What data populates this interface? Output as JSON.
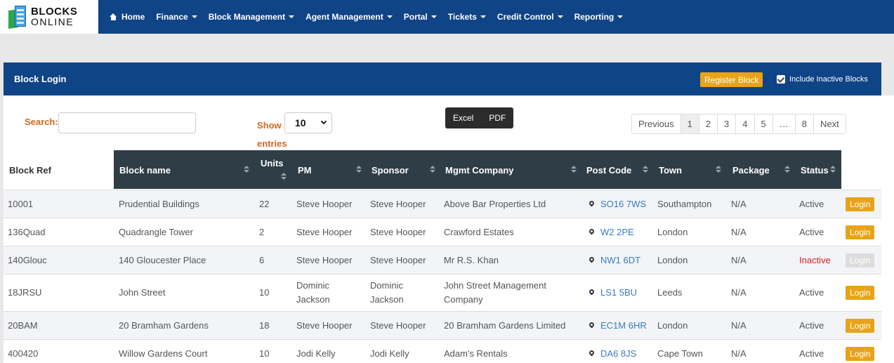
{
  "brand": {
    "line1": "BLOCKS",
    "line2": "ONLINE"
  },
  "nav": {
    "home": "Home",
    "items": [
      "Finance",
      "Block Management",
      "Agent Management",
      "Portal",
      "Tickets",
      "Credit Control",
      "Reporting"
    ]
  },
  "panel": {
    "title": "Block Login",
    "register_label": "Register Block",
    "include_inactive_label": "Include Inactive Blocks",
    "include_inactive_checked": true
  },
  "controls": {
    "search_label": "Search:",
    "search_value": "",
    "show_label": "Show",
    "entries_label": "entries",
    "page_size": "10",
    "export": [
      "Excel",
      "PDF"
    ]
  },
  "pagination": [
    "Previous",
    "1",
    "2",
    "3",
    "4",
    "5",
    "…",
    "8",
    "Next"
  ],
  "pagination_active": "1",
  "table": {
    "headers": {
      "ref": "Block Ref",
      "name": "Block name",
      "units": "Units",
      "pm": "PM",
      "sponsor": "Sponsor",
      "company": "Mgmt Company",
      "postcode": "Post Code",
      "town": "Town",
      "package": "Package",
      "status": "Status"
    },
    "rows": [
      {
        "ref": "10001",
        "name": "Prudential Buildings",
        "units": "22",
        "pm": "Steve Hooper",
        "sponsor": "Steve Hooper",
        "company": "Above Bar Properties Ltd",
        "postcode": "SO16 7WS",
        "town": "Southampton",
        "package": "N/A",
        "status": "Active",
        "action": "Login"
      },
      {
        "ref": "136Quad",
        "name": "Quadrangle Tower",
        "units": "2",
        "pm": "Steve Hooper",
        "sponsor": "Steve Hooper",
        "company": "Crawford Estates",
        "postcode": "W2 2PE",
        "town": "London",
        "package": "N/A",
        "status": "Active",
        "action": "Login"
      },
      {
        "ref": "140Glouc",
        "name": "140 Gloucester Place",
        "units": "6",
        "pm": "Steve Hooper",
        "sponsor": "Steve Hooper",
        "company": "Mr R.S. Khan",
        "postcode": "NW1 6DT",
        "town": "London",
        "package": "N/A",
        "status": "Inactive",
        "action": "Login"
      },
      {
        "ref": "18JRSU",
        "name": "John Street",
        "units": "10",
        "pm": "Dominic Jackson",
        "sponsor": "Dominic Jackson",
        "company": "John Street Management Company",
        "postcode": "LS1 5BU",
        "town": "Leeds",
        "package": "N/A",
        "status": "Active",
        "action": "Login"
      },
      {
        "ref": "20BAM",
        "name": "20 Bramham Gardens",
        "units": "18",
        "pm": "Steve Hooper",
        "sponsor": "Steve Hooper",
        "company": "20 Bramham Gardens Limited",
        "postcode": "EC1M 6HR",
        "town": "London",
        "package": "N/A",
        "status": "Active",
        "action": "Login"
      },
      {
        "ref": "400420",
        "name": "Willow Gardens Court",
        "units": "10",
        "pm": "Jodi Kelly",
        "sponsor": "Jodi Kelly",
        "company": "Adam's Rentals",
        "postcode": "DA6 8JS",
        "town": "Cape Town",
        "package": "N/A",
        "status": "Active",
        "action": "Login"
      }
    ]
  },
  "colors": {
    "nav_bg": "#0f4486",
    "accent": "#e8a317",
    "table_head": "#2f3e46",
    "inactive": "#e02020",
    "link": "#3a7bbf"
  }
}
